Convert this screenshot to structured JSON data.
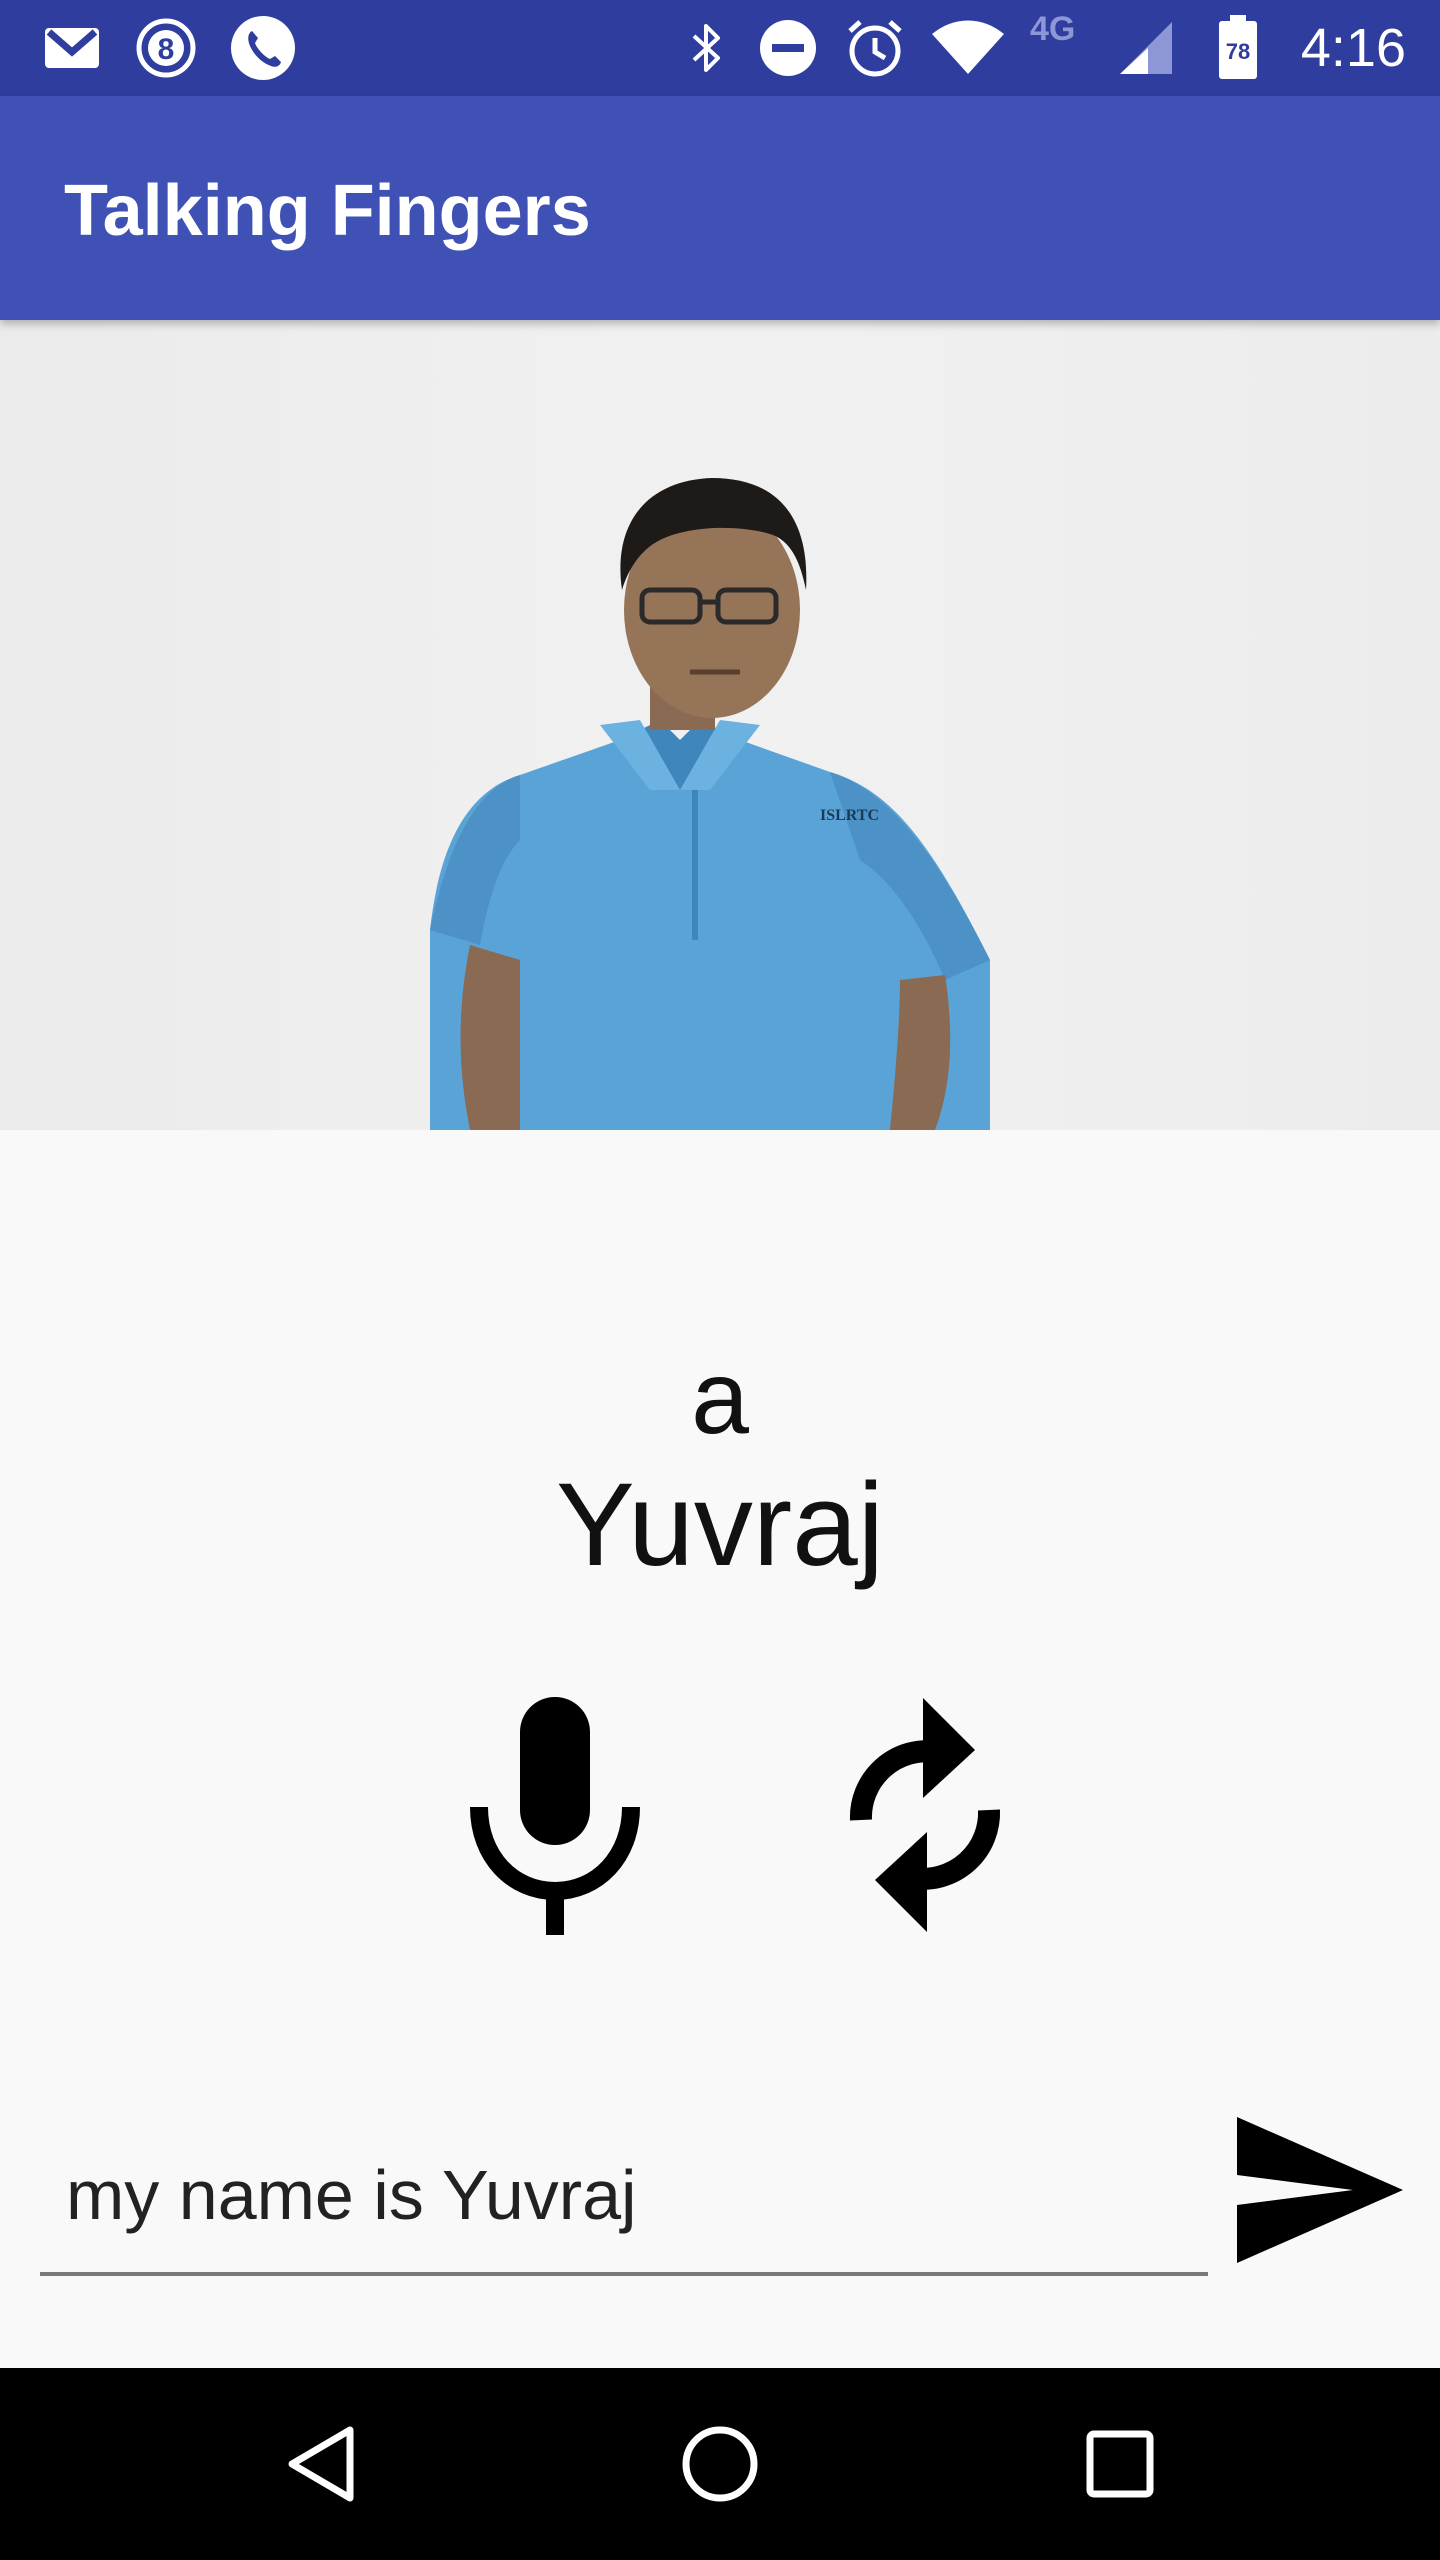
{
  "status_bar": {
    "time": "4:16",
    "network_label": "4G",
    "battery_level": "78",
    "icons": [
      "gmail-icon",
      "badge-8-icon",
      "phone-icon",
      "bluetooth-icon",
      "do-not-disturb-icon",
      "alarm-icon",
      "wifi-icon",
      "signal-icon",
      "battery-icon"
    ]
  },
  "app_bar": {
    "title": "Talking Fingers"
  },
  "video": {
    "shirt_text": "ISLRTC"
  },
  "content": {
    "previous_word": "a",
    "current_word": "Yuvraj",
    "input_value": "my name is Yuvraj"
  },
  "actions": {
    "mic": "mic-icon",
    "refresh": "refresh-icon",
    "send": "send-icon"
  },
  "nav_bar": {
    "buttons": [
      "back-icon",
      "home-icon",
      "recents-icon"
    ]
  },
  "colors": {
    "status_bar": "#2f3d9e",
    "app_bar": "#3f51b5",
    "background": "#f9f9f9",
    "nav_bar": "#000000"
  }
}
